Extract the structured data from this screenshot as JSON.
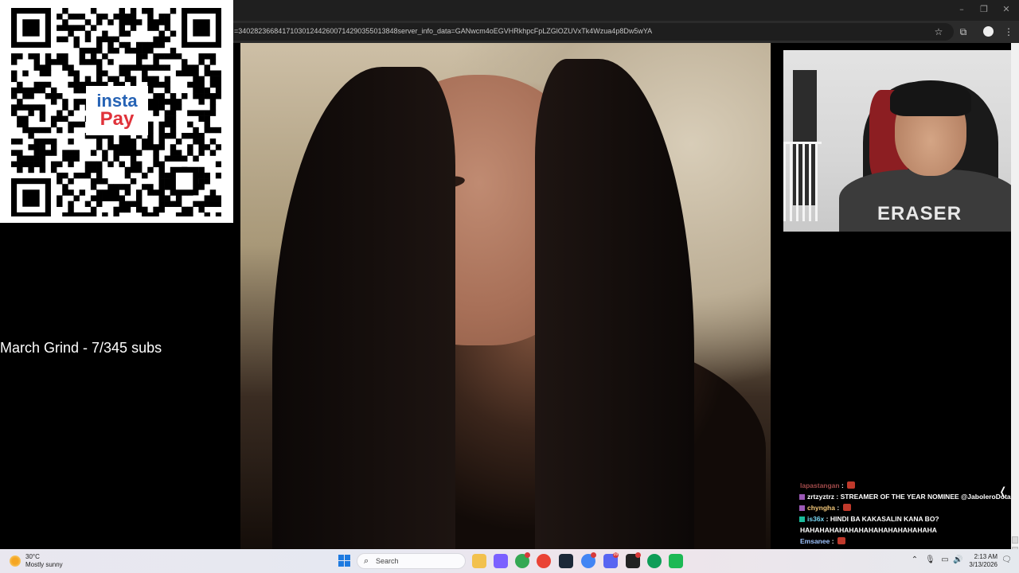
{
  "browser": {
    "url": "=3402823668417103012442600714290355013848server_info_data=GANwcm4oEGVHRkhpcFpLZGlOZUVxTk4Wzua4p8Dw5wYA",
    "window_controls": {
      "minimize": "–",
      "maximize": "❐",
      "close": "✕"
    },
    "toolbar_icons": {
      "bookmark": "☆",
      "extensions": "⧉",
      "menu": "⋮"
    }
  },
  "overlay": {
    "qr_brand_line1": "insta",
    "qr_brand_line2": "Pay",
    "goal_text": "March Grind - 7/345 subs",
    "webcam_shirt_text": "ERASER"
  },
  "chat": {
    "messages": [
      {
        "user": "lapastangan",
        "sep": " : ",
        "text": "",
        "user_color": "#a14a4a",
        "badge_color": "",
        "emote_color": "#c0392b"
      },
      {
        "user": "zrtzyztrz",
        "sep": " : ",
        "text": "STREAMER OF THE YEAR NOMINEE @JaboleroDota",
        "user_color": "#ffffff",
        "badge_color": "#9b59b6",
        "emote_color": ""
      },
      {
        "user": "chyngha",
        "sep": " : ",
        "text": "",
        "user_color": "#f5c97a",
        "badge_color": "#9b59b6",
        "emote_color": "#c0392b"
      },
      {
        "user": "is36x",
        "sep": " : ",
        "text": "HINDI BA KAKASALIN KANA BO?",
        "user_color": "#7ad9f5",
        "badge_color": "#1abc9c",
        "emote_color": ""
      },
      {
        "user": "",
        "sep": "",
        "text": "HAHAHAHAHAHAHAHAHAHAHAHAHAHA",
        "user_color": "#ffffff",
        "badge_color": "",
        "emote_color": ""
      },
      {
        "user": "Emsanee",
        "sep": " : ",
        "text": "",
        "user_color": "#9ec3ff",
        "badge_color": "",
        "emote_color": "#c0392b"
      }
    ],
    "collapse_glyph": "❬"
  },
  "taskbar": {
    "weather_temp": "30°C",
    "weather_desc": "Mostly sunny",
    "search_placeholder": "Search",
    "search_glyph": "⌕",
    "tray": {
      "chevron": "⌃",
      "mic": "🎙",
      "display": "▭",
      "volume": "🔊",
      "notification": "🗨"
    },
    "clock_time": "2:13 AM",
    "clock_date": "3/13/2026",
    "apps": [
      {
        "name": "file-explorer",
        "color": "#f2c14e"
      },
      {
        "name": "copilot",
        "color": "#7b61ff"
      },
      {
        "name": "chrome-profile-1",
        "color": "#34a853"
      },
      {
        "name": "chrome",
        "color": "#ea4335"
      },
      {
        "name": "steam",
        "color": "#1b2838"
      },
      {
        "name": "chrome-profile-2",
        "color": "#4285f4"
      },
      {
        "name": "discord",
        "color": "#5865f2"
      },
      {
        "name": "app-dark",
        "color": "#222222"
      },
      {
        "name": "chrome-profile-3",
        "color": "#0f9d58"
      },
      {
        "name": "spotify-like",
        "color": "#1db954"
      }
    ],
    "badges": [
      {
        "app": "chrome-profile-1",
        "count": ""
      },
      {
        "app": "chrome-profile-2",
        "count": ""
      },
      {
        "app": "discord",
        "count": "99"
      },
      {
        "app": "app-dark",
        "count": ""
      }
    ]
  }
}
